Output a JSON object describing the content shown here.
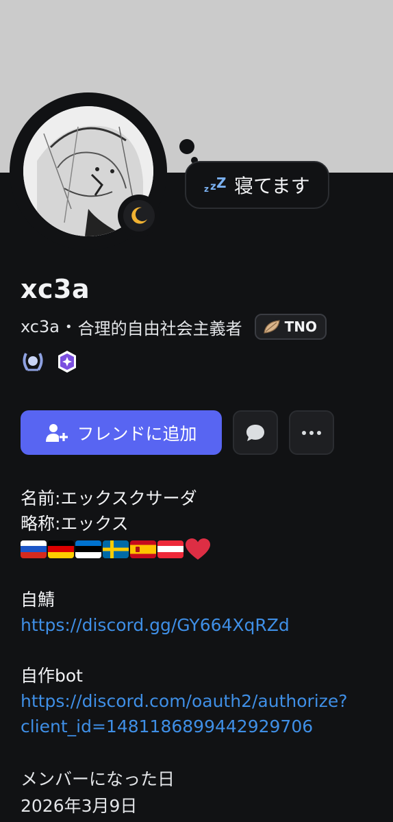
{
  "profile": {
    "display_name": "xc3a",
    "username": "xc3a",
    "separator": "•",
    "pronouns_text": "合理的自由社会主義者",
    "tag": "TNO",
    "status_text": "寝てます",
    "status_state": "idle"
  },
  "actions": {
    "add_friend_label": "フレンドに追加"
  },
  "bio": {
    "line1": "名前:エックスクサーダ",
    "line2": "略称:エックス",
    "flags": [
      "russia-flag",
      "germany-flag",
      "estonia-flag",
      "sweden-flag",
      "spain-flag",
      "austria-flag",
      "heart"
    ],
    "server_label": "自鯖",
    "server_link": "https://discord.gg/GY664XqRZd",
    "bot_label": "自作bot",
    "bot_link_line1": "https://discord.com/oauth2/authorize?",
    "bot_link_line2": "client_id=1481186899442929706"
  },
  "member_since": {
    "title": "メンバーになった日",
    "date": "2026年3月9日"
  },
  "colors": {
    "banner": "#cbcbcb",
    "background": "#111214",
    "primary_button": "#5865f2",
    "link": "#3f8fe6",
    "idle_moon": "#f0b232"
  }
}
